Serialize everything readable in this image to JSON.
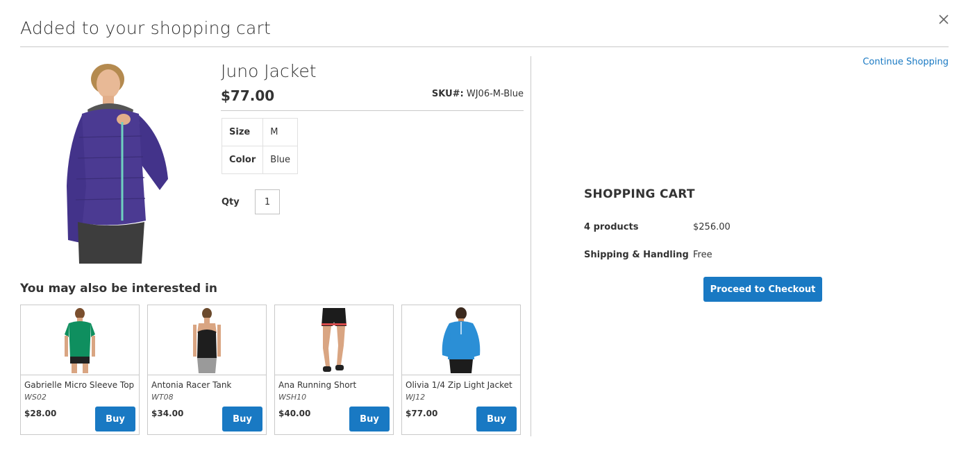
{
  "modal": {
    "title": "Added to your shopping cart",
    "close_icon": "close-icon"
  },
  "product": {
    "name": "Juno Jacket",
    "price": "$77.00",
    "sku_label": "SKU#:",
    "sku_value": "WJ06-M-Blue",
    "options": [
      {
        "label": "Size",
        "value": "M"
      },
      {
        "label": "Color",
        "value": "Blue"
      }
    ],
    "qty_label": "Qty",
    "qty_value": "1",
    "image_colors": {
      "jacket": "#4b3a92",
      "zip": "#6fd1c0",
      "pants": "#3d3d3d"
    }
  },
  "related": {
    "title": "You may also be interested in",
    "buy_label": "Buy",
    "items": [
      {
        "name": "Gabrielle Micro Sleeve Top",
        "sku": "WS02",
        "price": "$28.00",
        "garment_color": "#0f8f5f"
      },
      {
        "name": "Antonia Racer Tank",
        "sku": "WT08",
        "price": "$34.00",
        "garment_color": "#1e1e1e"
      },
      {
        "name": "Ana Running Short",
        "sku": "WSH10",
        "price": "$40.00",
        "garment_color": "#1c1c1c"
      },
      {
        "name": "Olivia 1/4 Zip Light Jacket",
        "sku": "WJ12",
        "price": "$77.00",
        "garment_color": "#2b8fd6"
      }
    ]
  },
  "cart": {
    "continue_label": "Continue Shopping",
    "title": "SHOPPING CART",
    "products_label": "4 products",
    "products_total": "$256.00",
    "shipping_label": "Shipping & Handling",
    "shipping_value": "Free",
    "checkout_label": "Proceed to Checkout"
  },
  "colors": {
    "accent": "#1979c3",
    "text": "#333333",
    "border": "#c9c9c9"
  }
}
